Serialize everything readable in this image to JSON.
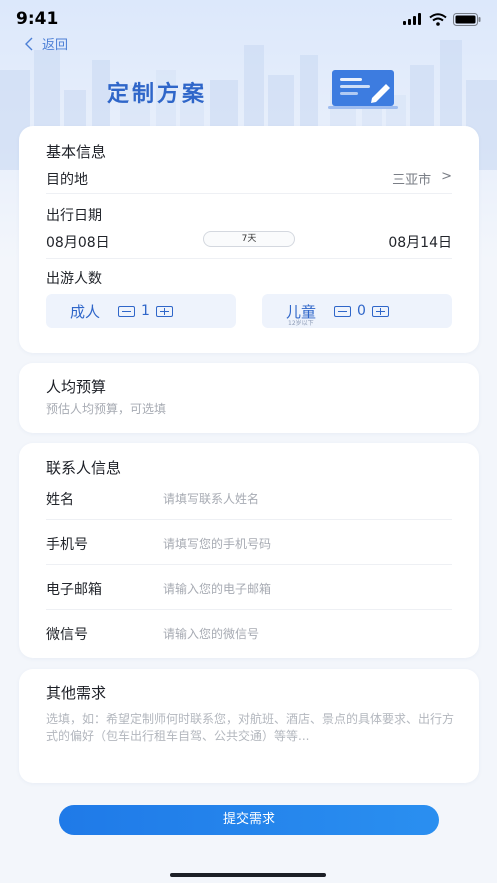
{
  "status_bar": {
    "time": "9:41"
  },
  "nav": {
    "back_label": "返回"
  },
  "header": {
    "title": "定制方案"
  },
  "basic_info": {
    "title": "基本信息",
    "destination_label": "目的地",
    "destination_value": "三亚市",
    "destination_chevron": ">",
    "date_label": "出行日期",
    "start_date": "08月08日",
    "duration": "7天",
    "end_date": "08月14日",
    "travelers_label": "出游人数",
    "adults_label": "成人",
    "adults_count": "1",
    "children_label": "儿童",
    "children_sub": "12岁以下",
    "children_count": "0"
  },
  "budget": {
    "title": "人均预算",
    "placeholder": "预估人均预算，可选填"
  },
  "contact": {
    "title": "联系人信息",
    "fields": [
      {
        "label": "姓名",
        "placeholder": "请填写联系人姓名"
      },
      {
        "label": "手机号",
        "placeholder": "请填写您的手机号码"
      },
      {
        "label": "电子邮箱",
        "placeholder": "请输入您的电子邮箱"
      },
      {
        "label": "微信号",
        "placeholder": "请输入您的微信号"
      }
    ]
  },
  "other": {
    "title": "其他需求",
    "placeholder": "选填，如：希望定制师何时联系您，对航班、酒店、景点的具体要求、出行方式的偏好（包车出行租车自驾、公共交通）等等..."
  },
  "submit": {
    "label": "提交需求"
  },
  "colors": {
    "accent": "#2f66c9",
    "button": "#1f7ae8",
    "placeholder": "#a7abb3"
  },
  "icons": [
    "signal-icon",
    "wifi-icon",
    "battery-icon",
    "back-arrow-icon",
    "document-illustration"
  ]
}
